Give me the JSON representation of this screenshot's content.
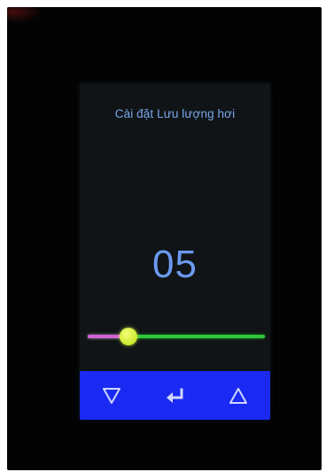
{
  "screen": {
    "title": "Cài đặt Lưu lượng hơi",
    "value": "05"
  },
  "slider": {
    "level_fraction": 0.23
  },
  "buttons": [
    {
      "icon": "down-triangle-icon"
    },
    {
      "icon": "enter-arrow-icon"
    },
    {
      "icon": "up-triangle-icon"
    }
  ],
  "colors": {
    "screen_bg": "#101416",
    "text": "#7aa6ee",
    "value": "#6a9af0",
    "slider_track": "#2fc63a",
    "slider_fill": "#d560d6",
    "slider_thumb": "#d7f03a",
    "button_bar": "#1a2af2",
    "button_icon": "#cfd6ff"
  }
}
